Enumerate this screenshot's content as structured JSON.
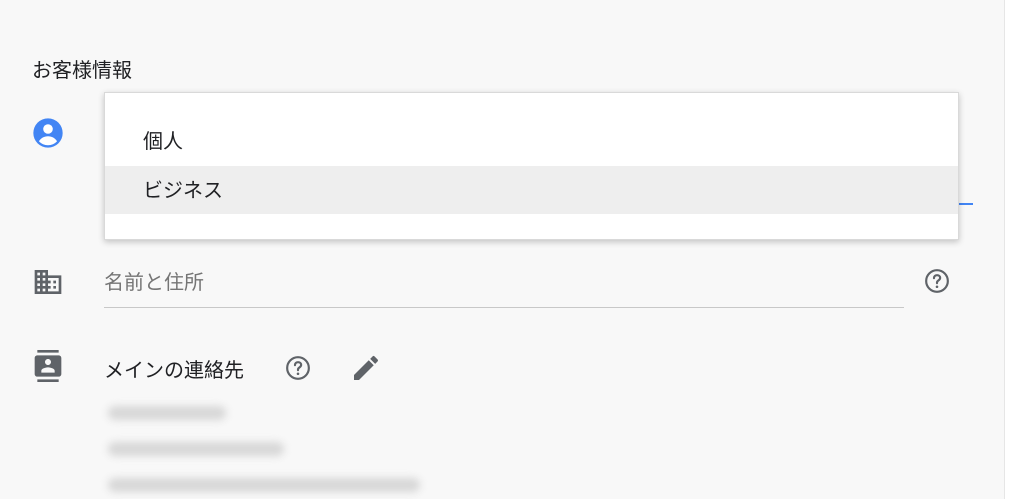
{
  "section": {
    "title": "お客様情報"
  },
  "account_type_menu": {
    "options": [
      {
        "label": "個人",
        "highlighted": false
      },
      {
        "label": "ビジネス",
        "highlighted": true
      }
    ]
  },
  "name_address": {
    "placeholder": "名前と住所",
    "help_icon": "help-circle-icon"
  },
  "main_contact": {
    "label": "メインの連絡先",
    "help_icon": "help-circle-icon",
    "edit_icon": "pencil-icon"
  },
  "icons": {
    "account": "account-circle-icon",
    "building": "building-icon",
    "contact": "contact-card-icon"
  },
  "colors": {
    "accent": "#4285f4",
    "icon_gray": "#5f6368",
    "highlight": "#eeeeee"
  }
}
